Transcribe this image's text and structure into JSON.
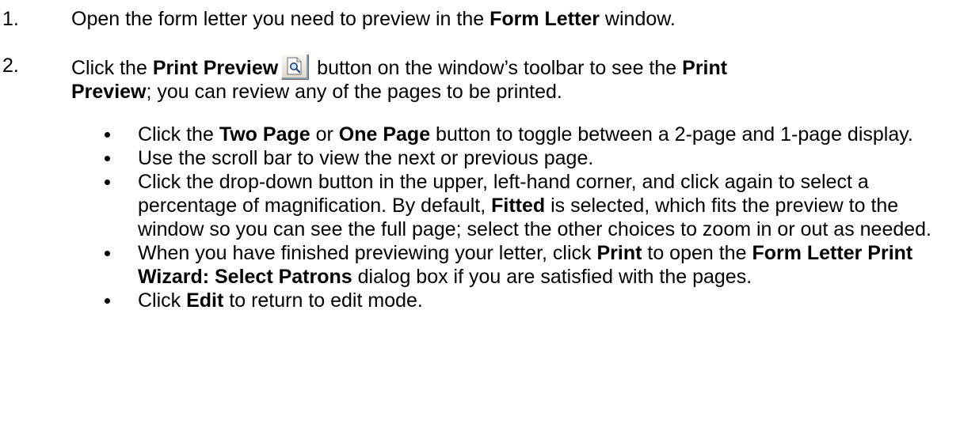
{
  "steps": [
    {
      "number": "1.",
      "parts": [
        "Open the form letter you need to preview in the ",
        "Form Letter",
        " window."
      ]
    },
    {
      "number": "2.",
      "line1": [
        "Click the ",
        "Print Preview",
        " button on the window’s toolbar to see the ",
        "Print"
      ],
      "line2": [
        "Preview",
        "; you can review any of the pages to be printed."
      ],
      "toolbar_icon": "print-preview-icon"
    }
  ],
  "bullets": [
    {
      "parts": [
        "Click the ",
        "Two Page",
        " or ",
        "One Page",
        " button to toggle between a 2-page and 1-page display."
      ]
    },
    {
      "parts": [
        "Use the scroll bar to view the next or previous page."
      ]
    },
    {
      "parts": [
        "Click the drop-down button in the upper, left-hand corner, and click again to select a percentage of magnification. By default, ",
        "Fitted",
        " is selected, which fits the preview to the window so you can see the full page; select the other choices to zoom in or out as needed."
      ]
    },
    {
      "parts": [
        "When you have finished previewing your letter, click ",
        "Print",
        " to open the ",
        "Form Letter Print Wizard: Select Patrons",
        " dialog box if you are satisfied with the pages."
      ]
    },
    {
      "parts": [
        "Click ",
        "Edit",
        " to return to edit mode."
      ]
    }
  ]
}
